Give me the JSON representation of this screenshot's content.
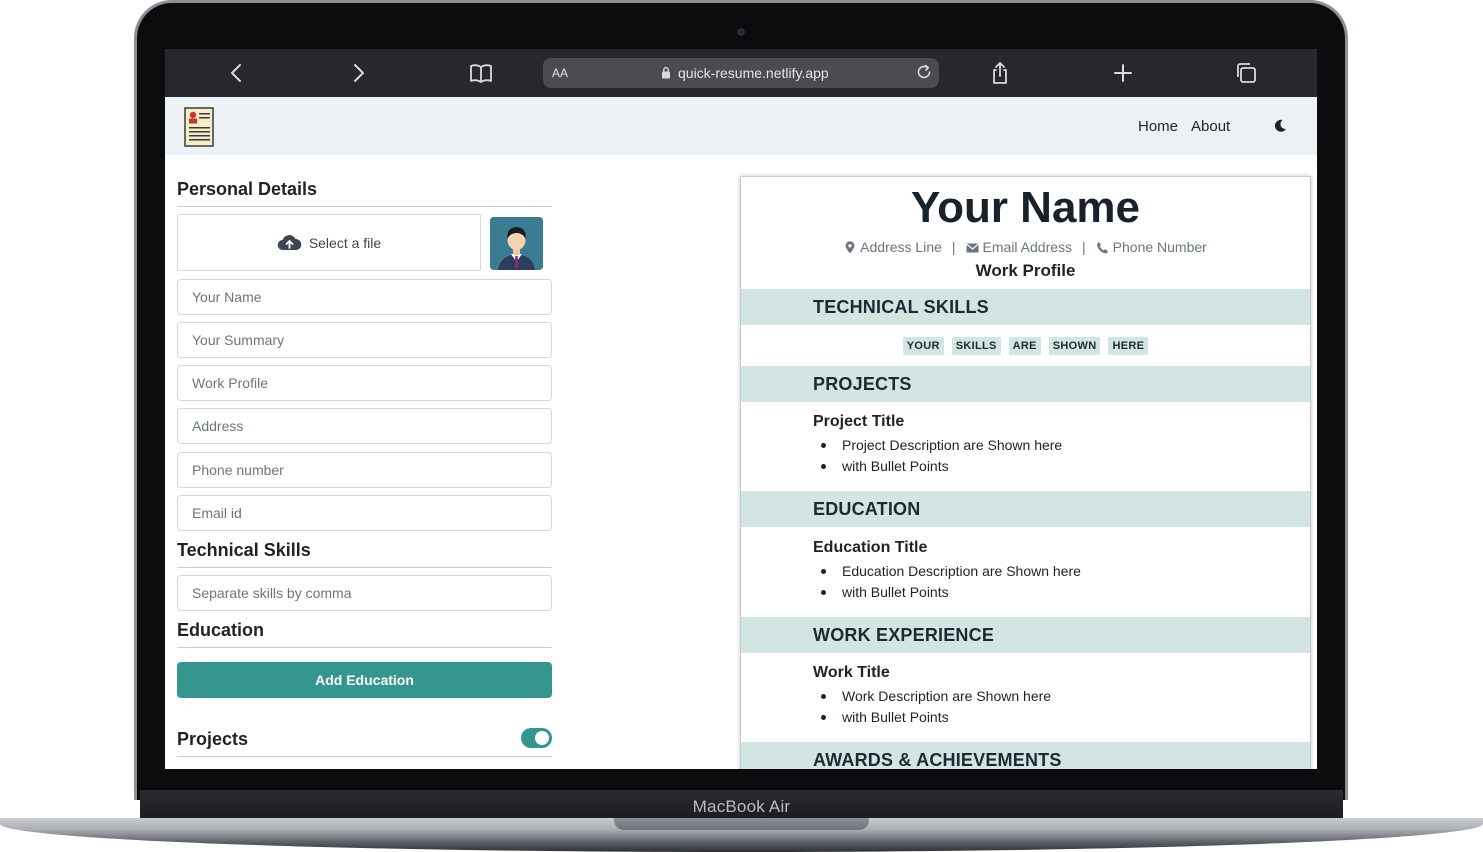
{
  "device": {
    "label": "MacBook Air"
  },
  "browser": {
    "aa_label": "AA",
    "url": "quick-resume.netlify.app"
  },
  "nav": {
    "links": [
      "Home",
      "About"
    ]
  },
  "form": {
    "personal_title": "Personal Details",
    "file_label": "Select a file",
    "fields": [
      {
        "placeholder": "Your Name"
      },
      {
        "placeholder": "Your Summary"
      },
      {
        "placeholder": "Work Profile"
      },
      {
        "placeholder": "Address"
      },
      {
        "placeholder": "Phone number"
      },
      {
        "placeholder": "Email id"
      }
    ],
    "skills_title": "Technical Skills",
    "skills_placeholder": "Separate skills by comma",
    "education_title": "Education",
    "add_education_label": "Add Education",
    "projects_title": "Projects",
    "projects_enabled": true
  },
  "resume": {
    "name": "Your Name",
    "address": "Address Line",
    "email": "Email Address",
    "phone": "Phone Number",
    "separator": "|",
    "profile": "Work Profile",
    "sections": {
      "skills": "TECHNICAL SKILLS",
      "projects": "PROJECTS",
      "education": "EDUCATION",
      "work": "WORK EXPERIENCE",
      "awards": "AWARDS & ACHIEVEMENTS"
    },
    "skills": [
      "YOUR",
      "SKILLS",
      "ARE",
      "SHOWN",
      "HERE"
    ],
    "project": {
      "title": "Project Title",
      "bullets": [
        "Project Description are Shown here",
        "with Bullet Points"
      ]
    },
    "education": {
      "title": "Education Title",
      "bullets": [
        "Education Description are Shown here",
        "with Bullet Points"
      ]
    },
    "work": {
      "title": "Work Title",
      "bullets": [
        "Work Description are Shown here",
        "with Bullet Points"
      ]
    }
  },
  "colors": {
    "accent": "#34968f",
    "band": "#d3e5e3",
    "nav_bg": "#ecf1f5",
    "safari_bg": "#26282c"
  }
}
